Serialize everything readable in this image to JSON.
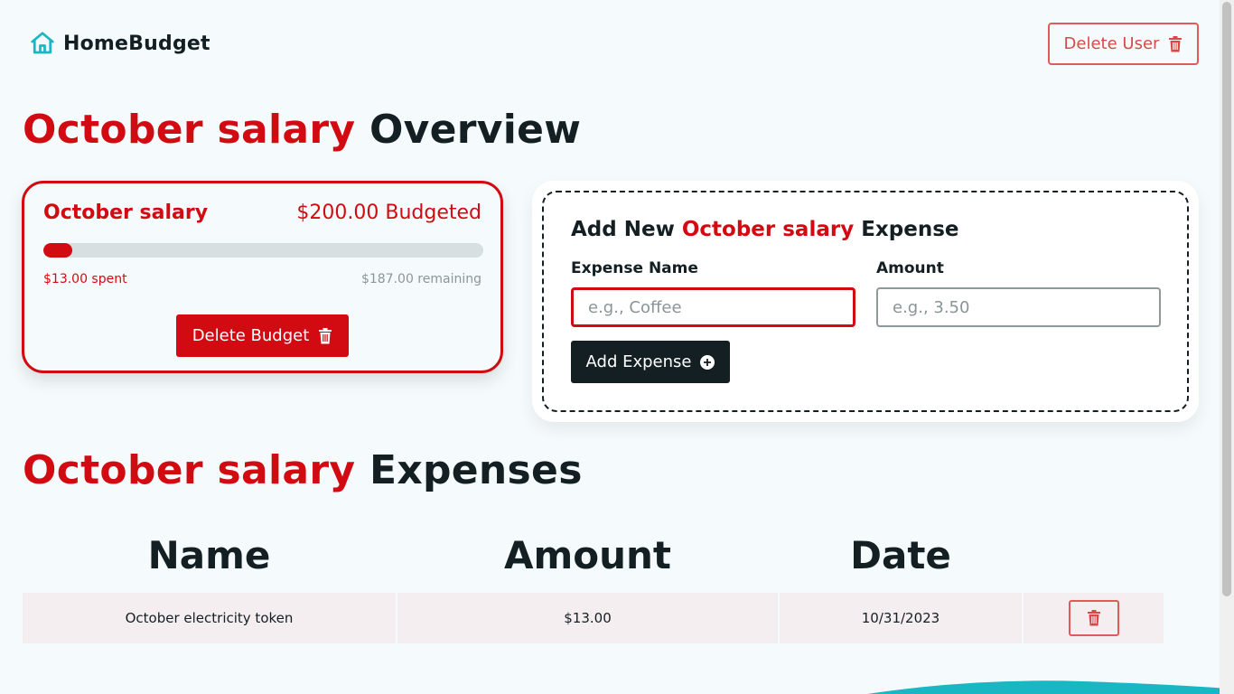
{
  "header": {
    "brand": "HomeBudget",
    "delete_user_label": "Delete User"
  },
  "overview": {
    "title_accent": "October salary",
    "title_rest": " Overview"
  },
  "budget_card": {
    "name": "October salary",
    "budgeted": "$200.00 Budgeted",
    "spent_label": "$13.00 spent",
    "remaining_label": "$187.00 remaining",
    "spent_fraction": 0.065,
    "delete_label": "Delete Budget"
  },
  "expense_form": {
    "title_prefix": "Add New ",
    "title_accent": "October salary",
    "title_suffix": " Expense",
    "name_label": "Expense Name",
    "name_placeholder": "e.g., Coffee",
    "name_value": "",
    "amount_label": "Amount",
    "amount_placeholder": "e.g., 3.50",
    "amount_value": "",
    "submit_label": "Add Expense"
  },
  "expenses_section": {
    "title_accent": "October salary",
    "title_rest": " Expenses"
  },
  "table": {
    "columns": [
      "Name",
      "Amount",
      "Date"
    ],
    "rows": [
      {
        "name": "October electricity token",
        "amount": "$13.00",
        "date": "10/31/2023"
      }
    ]
  },
  "colors": {
    "accent": "#d20b12",
    "dark": "#141f24",
    "background": "#f5fbfc",
    "brand_icon": "#19b7c4"
  },
  "icons": {
    "logo": "home-icon",
    "delete": "trash-icon",
    "add": "plus-circle-icon"
  }
}
